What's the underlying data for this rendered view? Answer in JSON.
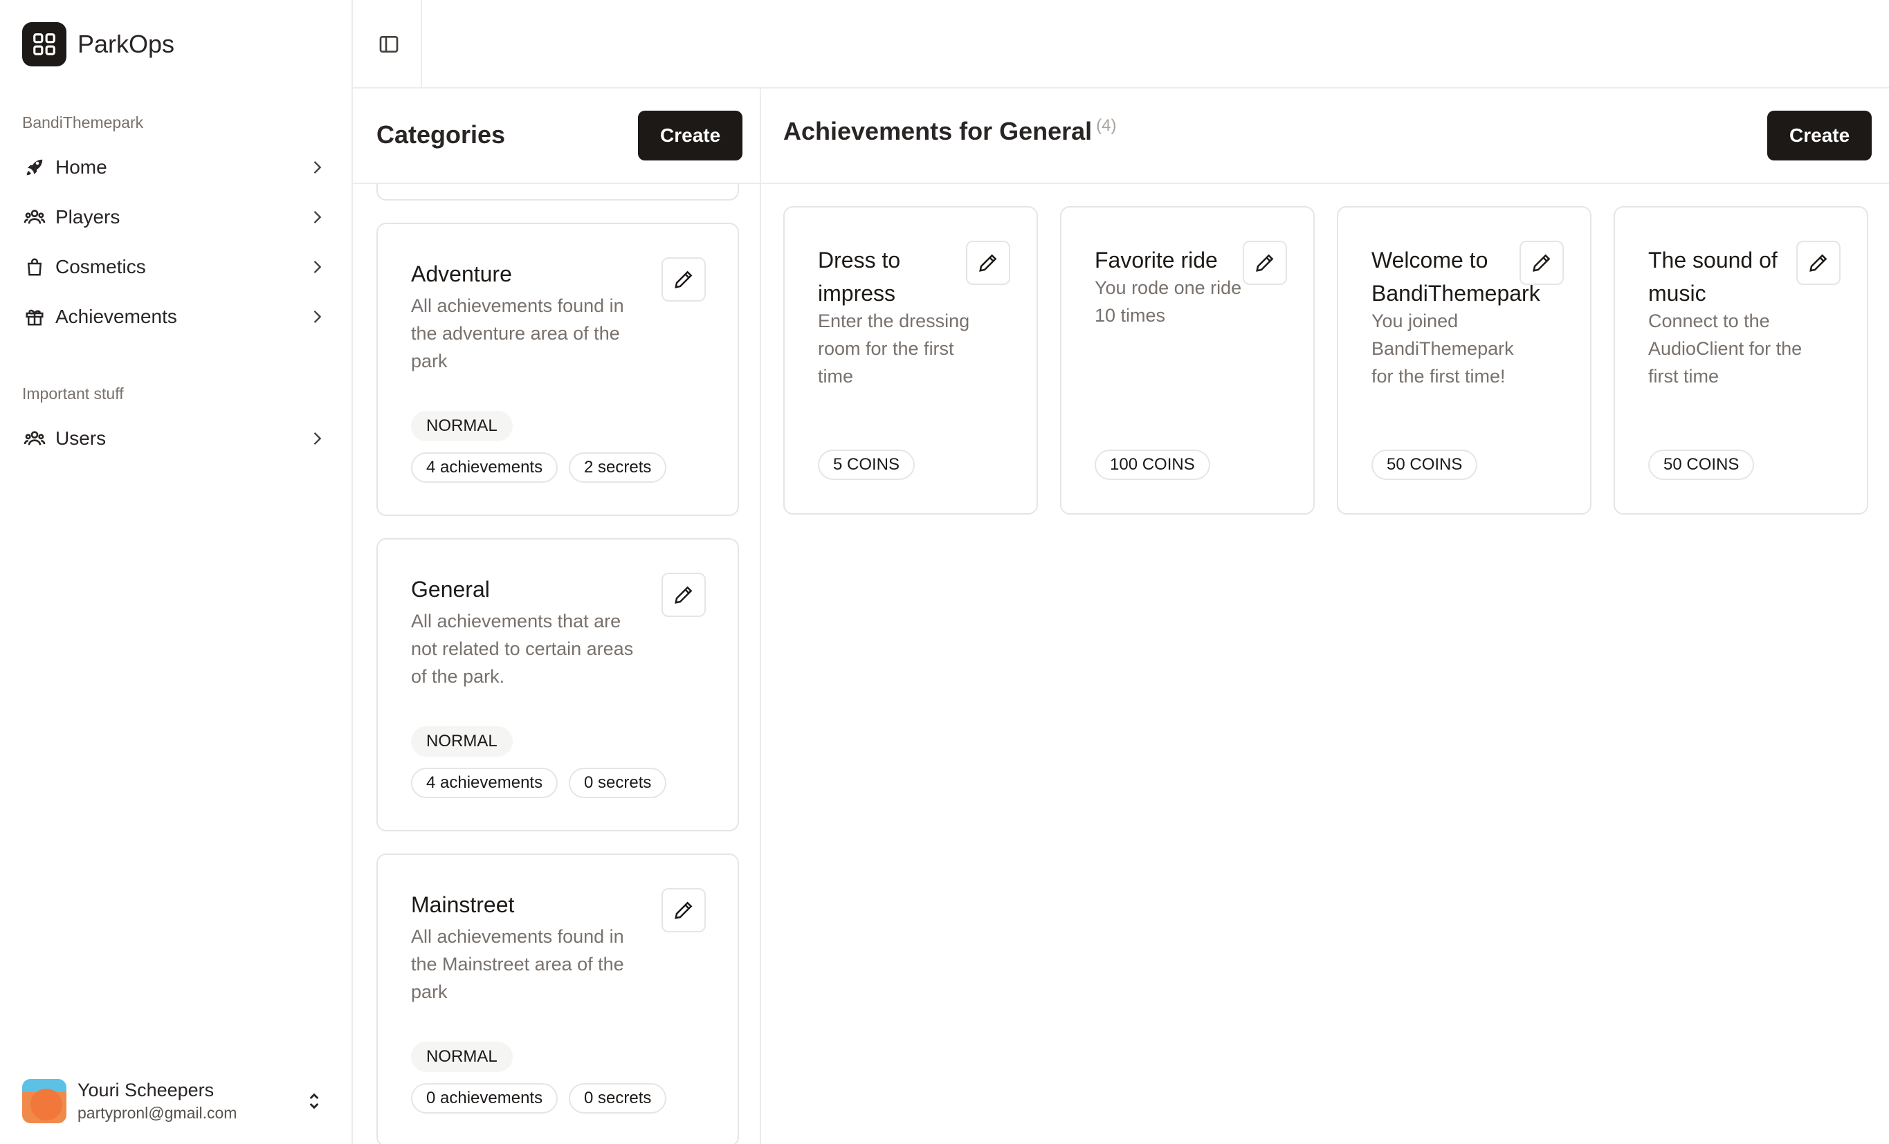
{
  "app": {
    "name": "ParkOps"
  },
  "sidebar": {
    "org_label": "BandiThemepark",
    "items": [
      {
        "label": "Home",
        "icon": "rocket-icon"
      },
      {
        "label": "Players",
        "icon": "users-icon"
      },
      {
        "label": "Cosmetics",
        "icon": "shopping-bag-icon"
      },
      {
        "label": "Achievements",
        "icon": "gift-icon"
      }
    ],
    "group2_label": "Important stuff",
    "items2": [
      {
        "label": "Users",
        "icon": "users-icon"
      }
    ],
    "user": {
      "name": "Youri Scheepers",
      "email": "partypronl@gmail.com"
    }
  },
  "categories": {
    "title": "Categories",
    "create_label": "Create",
    "items": [
      {
        "title": "Adventure",
        "description": "All achievements found in the adventure area of the park",
        "type": "NORMAL",
        "achievements": "4 achievements",
        "secrets": "2 secrets"
      },
      {
        "title": "General",
        "description": "All achievements that are not related to certain areas of the park.",
        "type": "NORMAL",
        "achievements": "4 achievements",
        "secrets": "0 secrets"
      },
      {
        "title": "Mainstreet",
        "description": "All achievements found in the Mainstreet area of the park",
        "type": "NORMAL",
        "achievements": "0 achievements",
        "secrets": "0 secrets"
      }
    ]
  },
  "achievements": {
    "title": "Achievements for General",
    "count": "(4)",
    "create_label": "Create",
    "items": [
      {
        "name": "Dress to impress",
        "description": "Enter the dressing room for the first time",
        "reward": "5 COINS"
      },
      {
        "name": "Favorite ride",
        "description": "You rode one ride 10 times",
        "reward": "100 COINS"
      },
      {
        "name": "Welcome to BandiThemepark",
        "description": "You joined BandiThemepark for the first time!",
        "reward": "50 COINS"
      },
      {
        "name": "The sound of music",
        "description": "Connect to the AudioClient for the first time",
        "reward": "50 COINS"
      }
    ]
  },
  "colors": {
    "primary": "#1c1917",
    "muted_text": "#78716c",
    "border": "#e7e5e4"
  }
}
